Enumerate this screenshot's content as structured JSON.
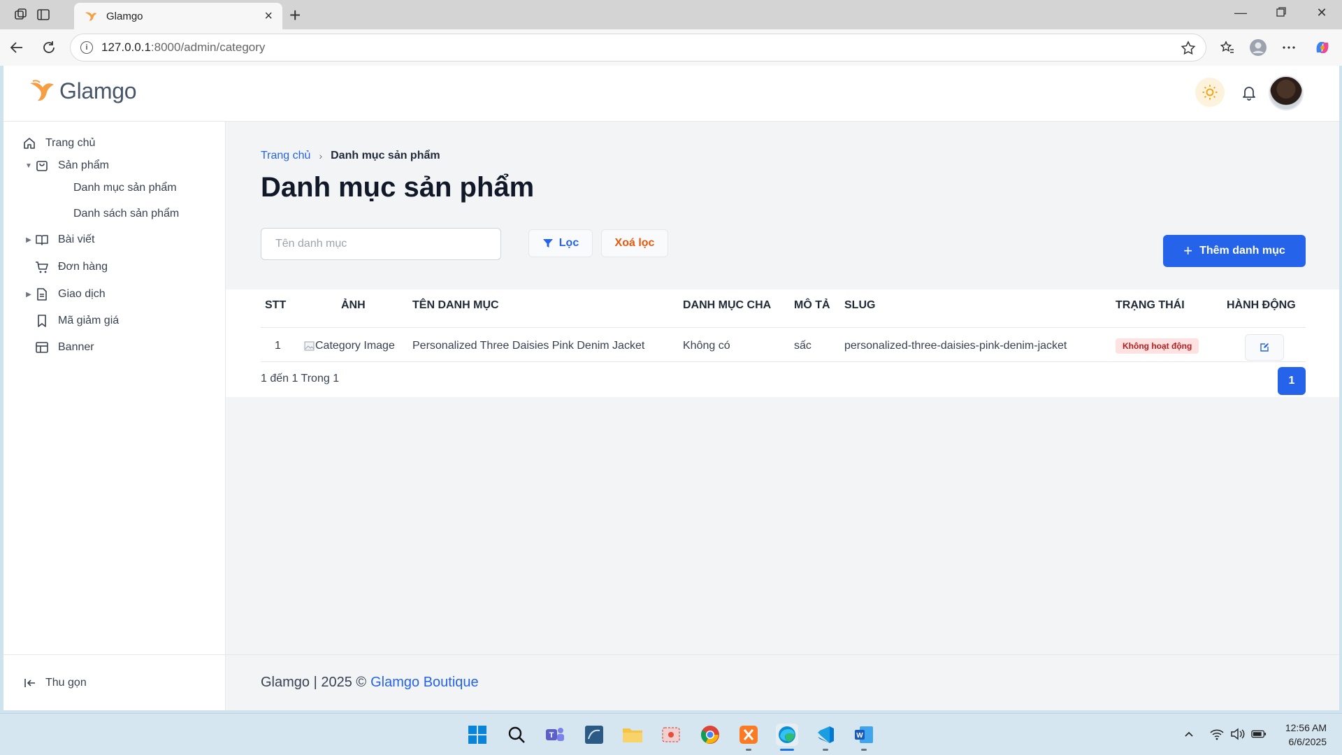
{
  "browser": {
    "tab_title": "Glamgo",
    "url_host": "127.0.0.1",
    "url_path": ":8000/admin/category"
  },
  "app": {
    "brand": "Glamgo",
    "accent": "#2563eb",
    "logo_color": "#f59e42"
  },
  "sidebar": {
    "items": [
      {
        "label": "Trang chủ",
        "icon": "home-icon"
      },
      {
        "label": "Sản phẩm",
        "icon": "bag-icon"
      },
      {
        "label": "Bài viết",
        "icon": "book-icon"
      },
      {
        "label": "Đơn hàng",
        "icon": "cart-icon"
      },
      {
        "label": "Giao dịch",
        "icon": "document-icon"
      },
      {
        "label": "Mã giảm giá",
        "icon": "bookmark-icon"
      },
      {
        "label": "Banner",
        "icon": "layout-icon"
      }
    ],
    "sub_items": [
      "Danh mục sản phẩm",
      "Danh sách sản phẩm"
    ],
    "collapse_label": "Thu gọn"
  },
  "breadcrumb": {
    "home": "Trang chủ",
    "current": "Danh mục sản phẩm"
  },
  "page": {
    "title": "Danh mục sản phẩm"
  },
  "filters": {
    "search_placeholder": "Tên danh mục",
    "filter_label": "Lọc",
    "clear_label": "Xoá lọc",
    "add_label": "Thêm danh mục"
  },
  "table": {
    "headers": [
      "STT",
      "ẢNH",
      "TÊN DANH MỤC",
      "DANH MỤC CHA",
      "MÔ TẢ",
      "SLUG",
      "TRẠNG THÁI",
      "HÀNH ĐỘNG"
    ],
    "rows": [
      {
        "stt": "1",
        "image_alt": "Category Image",
        "name": "Personalized Three Daisies Pink Denim Jacket",
        "parent": "Không có",
        "description": "sấc",
        "slug": "personalized-three-daisies-pink-denim-jacket",
        "status": "Không hoạt động"
      }
    ]
  },
  "pagination": {
    "info": "1 đến 1 Trong 1",
    "current_page": "1"
  },
  "footer": {
    "text": "Glamgo | 2025 ©",
    "link": "Glamgo Boutique"
  },
  "taskbar": {
    "time": "12:56 AM",
    "date": "6/6/2025"
  }
}
